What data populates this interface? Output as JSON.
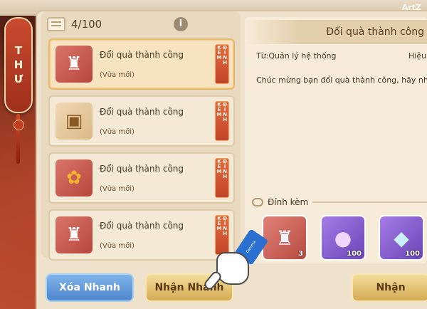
{
  "branding": {
    "watermark": "ArtZ"
  },
  "side_tab": {
    "label": "THƯ"
  },
  "mailbox": {
    "count": "4/100",
    "info_icon": "i",
    "items": [
      {
        "title": "Đổi quà thành công",
        "status": "(Vừa mới)",
        "tag": "ĐÍNH KÈM",
        "icon": "lantern-token-icon"
      },
      {
        "title": "Đổi quà thành công",
        "status": "(Vừa mới)",
        "tag": "ĐÍNH KÈM",
        "icon": "treasure-chest-icon"
      },
      {
        "title": "Đổi quà thành công",
        "status": "(Vừa mới)",
        "tag": "ĐÍNH KÈM",
        "icon": "gold-puzzle-icon"
      },
      {
        "title": "Đổi quà thành công",
        "status": "(Vừa mới)",
        "tag": "ĐÍNH KÈM",
        "icon": "lantern-token-icon"
      }
    ]
  },
  "detail": {
    "title": "Đổi quà thành công",
    "sender": "Từ:Quản lý hệ thống",
    "effect": "Hiệu",
    "body": "Chúc mừng bạn đổi quà thành công, hãy nhận phầ",
    "attachments_label": "Đính kèm",
    "rewards": [
      {
        "icon": "lantern-token-icon",
        "count": "3"
      },
      {
        "icon": "purple-orb-icon",
        "count": "100"
      },
      {
        "icon": "blue-crystal-icon",
        "count": "100"
      }
    ]
  },
  "buttons": {
    "delete_all": "Xóa Nhanh",
    "claim_all": "Nhận Nhanh",
    "claim": "Nhận"
  },
  "hand": {
    "sleeve_text": "Gamota"
  }
}
